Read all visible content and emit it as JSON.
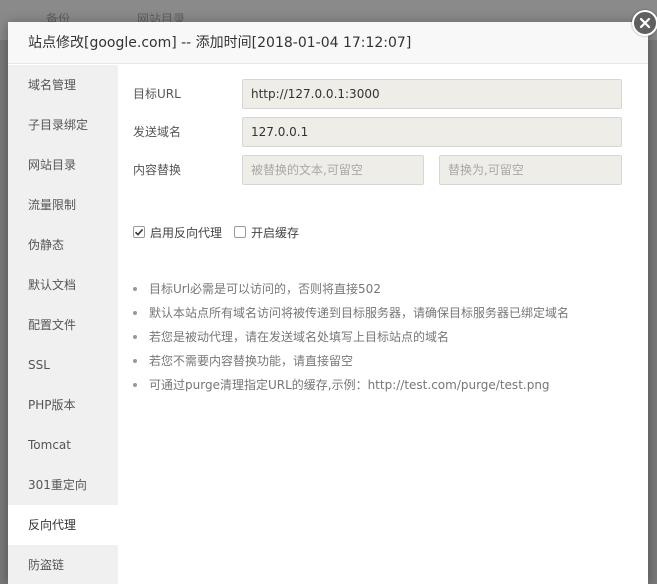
{
  "background": {
    "col1": "备份",
    "col2": "网站目录"
  },
  "dialog": {
    "title": "站点修改[google.com] -- 添加时间[2018-01-04 17:12:07]",
    "close_icon": "close-icon"
  },
  "sidebar": {
    "items": [
      {
        "label": "域名管理"
      },
      {
        "label": "子目录绑定"
      },
      {
        "label": "网站目录"
      },
      {
        "label": "流量限制"
      },
      {
        "label": "伪静态"
      },
      {
        "label": "默认文档"
      },
      {
        "label": "配置文件"
      },
      {
        "label": "SSL"
      },
      {
        "label": "PHP版本"
      },
      {
        "label": "Tomcat"
      },
      {
        "label": "301重定向"
      },
      {
        "label": "反向代理"
      },
      {
        "label": "防盗链"
      }
    ],
    "active_index": 11
  },
  "form": {
    "target_url_label": "目标URL",
    "target_url_value": "http://127.0.0.1:3000",
    "send_domain_label": "发送域名",
    "send_domain_value": "127.0.0.1",
    "content_replace_label": "内容替换",
    "replace_from_placeholder": "被替换的文本,可留空",
    "replace_to_placeholder": "替换为,可留空",
    "enable_proxy_label": "启用反向代理",
    "enable_proxy_checked": true,
    "enable_cache_label": "开启缓存",
    "enable_cache_checked": false
  },
  "tips": [
    "目标Url必需是可以访问的，否则将直接502",
    "默认本站点所有域名访问将被传递到目标服务器，请确保目标服务器已绑定域名",
    "若您是被动代理，请在发送域名处填写上目标站点的域名",
    "若您不需要内容替换功能，请直接留空",
    "可通过purge清理指定URL的缓存,示例：http://test.com/purge/test.png"
  ]
}
